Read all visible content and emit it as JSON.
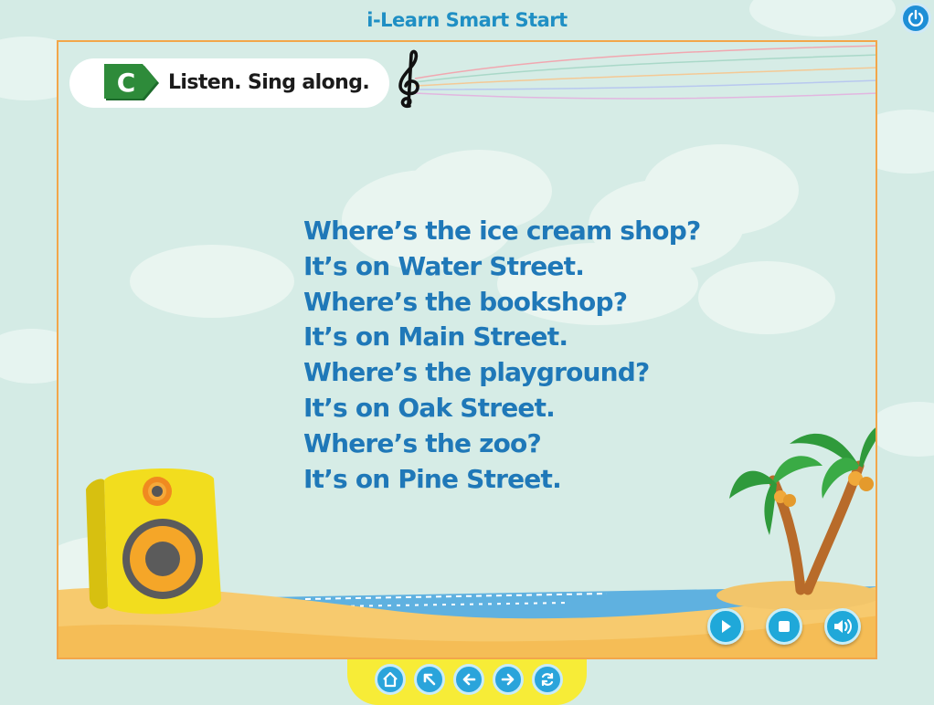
{
  "app": {
    "title": "i-Learn Smart Start"
  },
  "header": {
    "badge_letter": "C",
    "instruction": "Listen. Sing along."
  },
  "song": {
    "lines": [
      "Where’s the ice cream shop?",
      "It’s on Water Street.",
      "Where’s the bookshop?",
      "It’s on Main Street.",
      "Where’s the playground?",
      "It’s on Oak Street.",
      "Where’s the zoo?",
      "It’s on Pine Street."
    ]
  },
  "controls": [
    "play-icon",
    "stop-icon",
    "volume-icon"
  ],
  "navigation": [
    "home-icon",
    "arrow-up-left-icon",
    "arrow-left-icon",
    "arrow-right-icon",
    "refresh-icon"
  ],
  "colors": {
    "lyrics": "#1f78b8",
    "title": "#1f8fc4",
    "badge": "#2e8b3a",
    "frame": "#f2a64a",
    "button": "#1fa8d9",
    "nav_bar": "#f7ec37"
  }
}
